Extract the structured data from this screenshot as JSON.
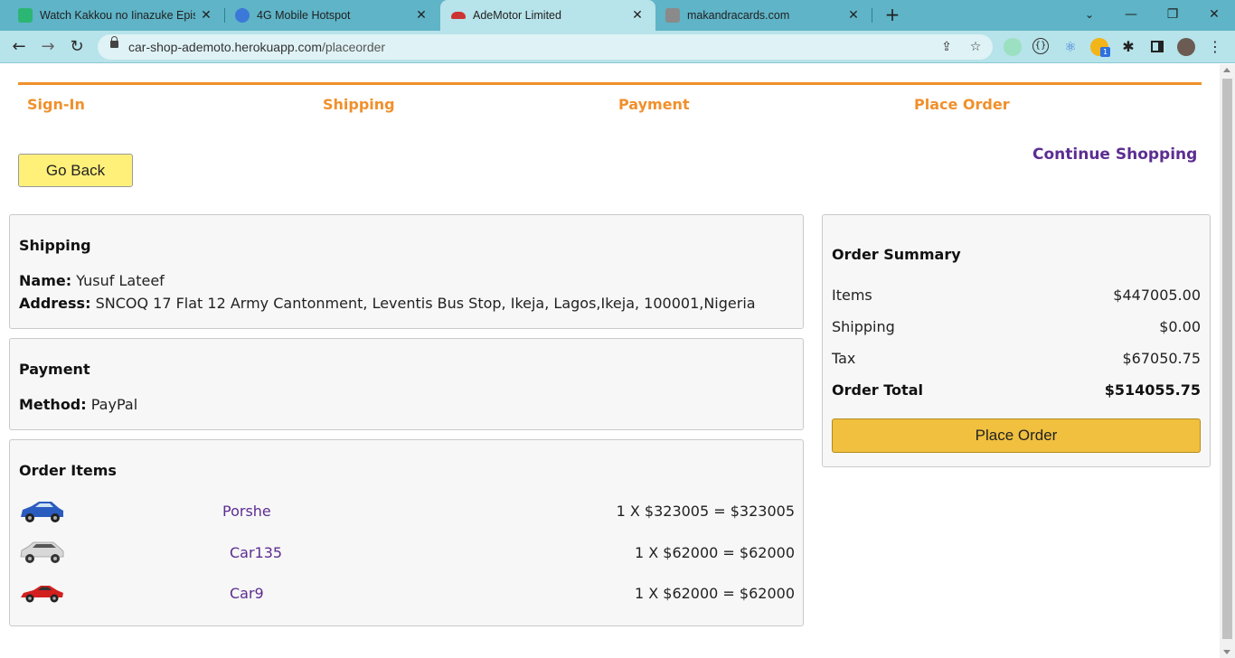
{
  "browser": {
    "tabs": [
      {
        "title": "Watch Kakkou no Iinazuke Episo",
        "icon": "tv-icon"
      },
      {
        "title": "4G Mobile Hotspot",
        "icon": "globe-icon"
      },
      {
        "title": "AdeMotor Limited",
        "icon": "car-icon"
      },
      {
        "title": "makandracards.com",
        "icon": "cards-icon"
      }
    ],
    "url_host": "car-shop-ademoto.herokuapp.com",
    "url_path": "/placeorder",
    "extension_badge": "1"
  },
  "steps": [
    "Sign-In",
    "Shipping",
    "Payment",
    "Place Order"
  ],
  "go_back_label": "Go Back",
  "continue_label": "Continue Shopping",
  "shipping": {
    "heading": "Shipping",
    "name_label": "Name:",
    "name_value": "Yusuf Lateef",
    "address_label": "Address:",
    "address_value": "SNCOQ 17 Flat 12 Army Cantonment, Leventis Bus Stop, Ikeja, Lagos,Ikeja, 100001,Nigeria"
  },
  "payment": {
    "heading": "Payment",
    "method_label": "Method:",
    "method_value": "PayPal"
  },
  "order_items": {
    "heading": "Order Items",
    "items": [
      {
        "name": "Porshe",
        "calc": "1 X $323005 = $323005",
        "color": "#2a5bbf"
      },
      {
        "name": "Car135",
        "calc": "1 X $62000 = $62000",
        "color": "#d8d8d8"
      },
      {
        "name": "Car9",
        "calc": "1 X $62000 = $62000",
        "color": "#d41f1f"
      }
    ]
  },
  "summary": {
    "heading": "Order Summary",
    "items_label": "Items",
    "items_value": "$447005.00",
    "shipping_label": "Shipping",
    "shipping_value": "$0.00",
    "tax_label": "Tax",
    "tax_value": "$67050.75",
    "total_label": "Order Total",
    "total_value": "$514055.75",
    "place_order_label": "Place Order"
  }
}
